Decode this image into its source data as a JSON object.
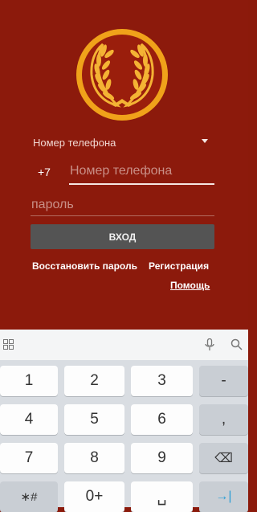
{
  "login": {
    "selector_label": "Номер телефона",
    "country_code": "+7",
    "phone_placeholder": "Номер телефона",
    "password_placeholder": "пароль",
    "login_button": "ВХОД",
    "restore_link": "Восстановить пароль",
    "register_link": "Регистрация",
    "help_link": "Помощь"
  },
  "keyboard": {
    "keys": [
      "1",
      "2",
      "3",
      "-",
      "4",
      "5",
      "6",
      ",",
      "7",
      "8",
      "9",
      "⌫",
      "∗#",
      "0+",
      "␣",
      "→|"
    ]
  },
  "colors": {
    "background": "#8c1a0c",
    "logo_gold": "#f2a51a",
    "button": "#545454",
    "enter_key": "#2c9fd6"
  }
}
